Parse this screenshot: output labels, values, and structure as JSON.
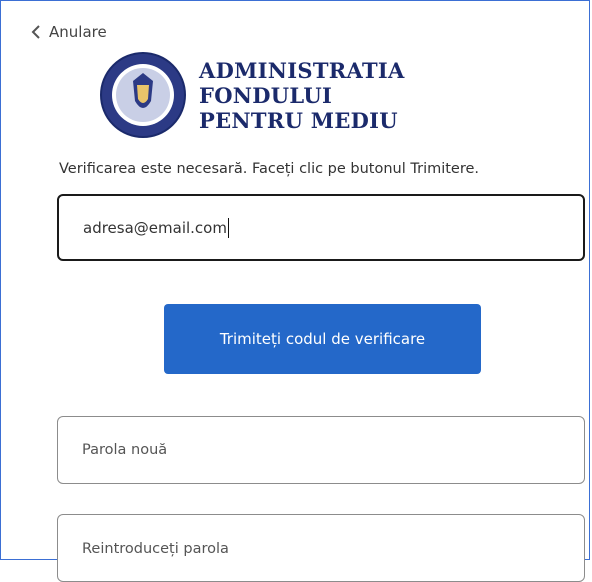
{
  "nav": {
    "cancel_label": "Anulare"
  },
  "header": {
    "org_name_lines": [
      "ADMINISTRATIA",
      "FONDULUI",
      "PENTRU MEDIU"
    ]
  },
  "form": {
    "intro_text": "Verificarea este necesară. Faceți clic pe butonul Trimitere.",
    "email_value": "adresa@email.com",
    "send_code_label": "Trimiteți codul de verificare",
    "new_password_placeholder": "Parola nouă",
    "confirm_password_placeholder": "Reintroduceți parola"
  },
  "colors": {
    "accent": "#2468c9",
    "brand_navy": "#1b2a6b",
    "frame_border": "#3b6fd4"
  },
  "icons": {
    "back": "chevron-left-icon",
    "seal": "government-seal-icon"
  }
}
